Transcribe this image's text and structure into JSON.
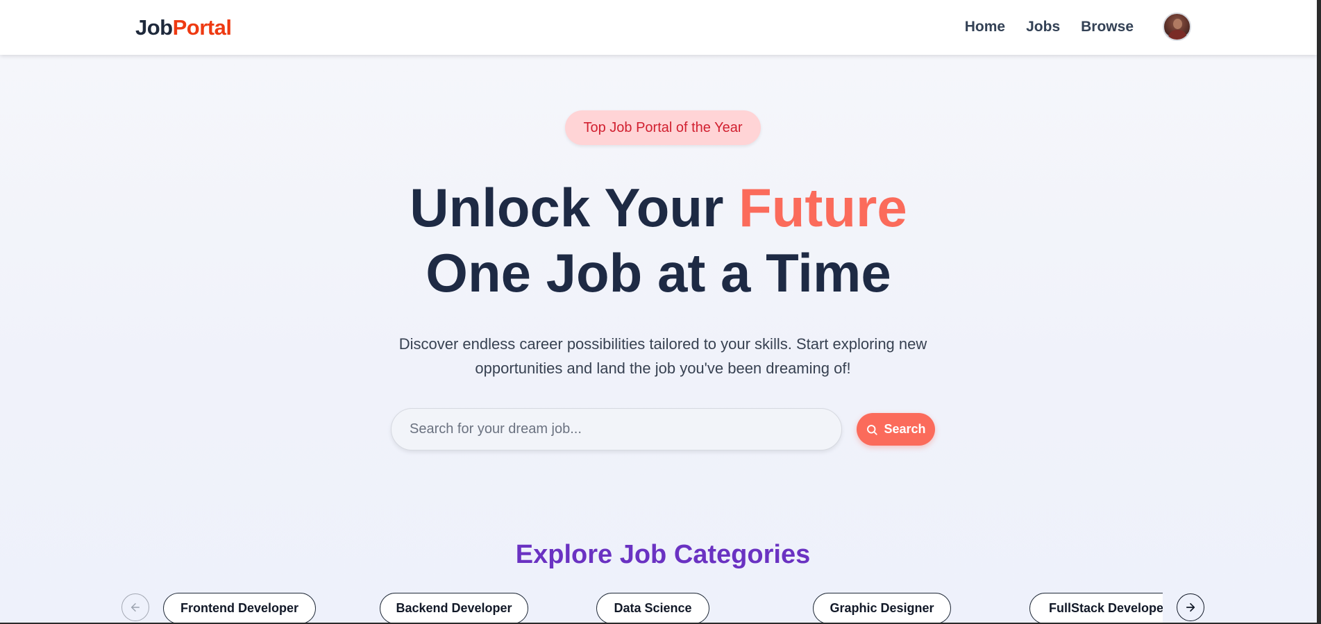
{
  "navbar": {
    "logo_part1": "Job",
    "logo_part2": "Portal",
    "links": [
      {
        "label": "Home"
      },
      {
        "label": "Jobs"
      },
      {
        "label": "Browse"
      }
    ]
  },
  "hero": {
    "badge": "Top Job Portal of the Year",
    "headline_line1_start": "Unlock Your ",
    "headline_line1_accent": "Future",
    "headline_line2": "One Job at a Time",
    "subtext_line1": "Discover endless career possibilities tailored to your skills. Start exploring new",
    "subtext_line2": "opportunities and land the job you've been dreaming of!"
  },
  "search": {
    "placeholder": "Search for your dream job...",
    "button_label": "Search",
    "button_icon": "search-icon"
  },
  "categories": {
    "title": "Explore Job Categories",
    "prev_icon": "arrow-left-icon",
    "next_icon": "arrow-right-icon",
    "items": [
      {
        "label": "Frontend Developer"
      },
      {
        "label": "Backend Developer"
      },
      {
        "label": "Data Science"
      },
      {
        "label": "Graphic Designer"
      },
      {
        "label": "FullStack Developer"
      }
    ]
  },
  "colors": {
    "brand_dark": "#1e293b",
    "brand_accent": "#ee3a12",
    "primary_coral": "#fb6b5b",
    "badge_bg": "#ffd4d6",
    "badge_text": "#d11f2f",
    "section_title": "#6a32c2"
  }
}
